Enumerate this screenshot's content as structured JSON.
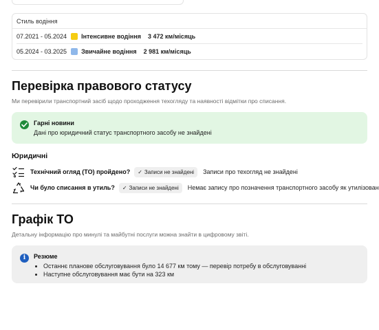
{
  "driving_style": {
    "header": "Стиль водіння",
    "rows": [
      {
        "period": "07.2021 - 05.2024",
        "color": "#f5cc12",
        "name": "Інтенсивне водіння",
        "value": "3 472 км/місяць"
      },
      {
        "period": "05.2024 - 03.2025",
        "color": "#8fb8ea",
        "name": "Звичайне водіння",
        "value": "2 981 км/місяць"
      }
    ]
  },
  "legal_status": {
    "title": "Перевірка правового статусу",
    "subtitle": "Ми перевірили транспортний засіб щодо проходження техогляду та наявності відмітки про списання.",
    "good_news": {
      "title": "Гарні новини",
      "text": "Дані про юридичний статус транспортного засобу не знайдені"
    },
    "section_title": "Юридичні",
    "items": [
      {
        "icon": "checklist-icon",
        "question": "Технічний огляд (ТО) пройдено?",
        "chip": "Записи не знайдені",
        "answer": "Записи про техогляд не знайдені"
      },
      {
        "icon": "recycle-icon",
        "question": "Чи було списання в утиль?",
        "chip": "Записи не знайдені",
        "answer": "Немає запису про позначення транспортного засобу як утилізованого"
      }
    ]
  },
  "service_schedule": {
    "title": "Графік ТО",
    "subtitle": "Детальну інформацію про минулі та майбутні послуги можна знайти в цифровому звіті.",
    "summary": {
      "title": "Резюме",
      "items": [
        "Останнє планове обслуговування було 14 677 км тому — перевір потребу в обслуговуванні",
        "Наступне обслуговування має бути на 323 км"
      ]
    }
  }
}
